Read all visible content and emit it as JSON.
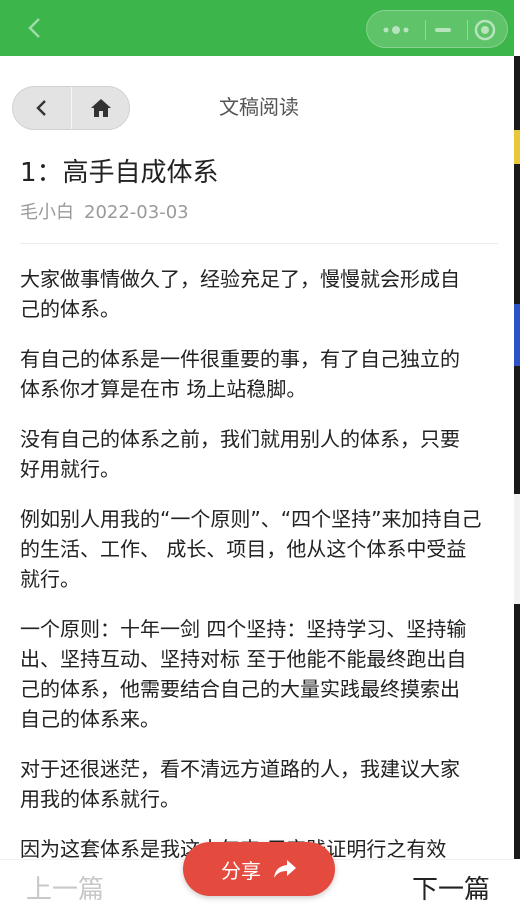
{
  "navbar": {
    "title": "文稿阅读"
  },
  "article": {
    "title": "1：高手自成体系",
    "author": "毛小白",
    "date": "2022-03-03",
    "paragraphs": [
      [
        "大家做事情做久了，经验充足了，慢慢就会形成自",
        "己的体系。"
      ],
      [
        "有自己的体系是一件很重要的事，有了自己独立的",
        "体系你才算是在市 场上站稳脚。"
      ],
      [
        "没有自己的体系之前，我们就用别人的体系，只要",
        "好用就行。"
      ],
      [
        "例如别人用我的“一个原则”、“四个坚持”来加持自己",
        "的生活、工作、 成长、项目，他从这个体系中受益",
        "就行。"
      ],
      [
        "一个原则：十年一剑 四个坚持：坚持学习、坚持输",
        "出、坚持互动、坚持对标 至于他能不能最终跑出自",
        "己的体系，他需要结合自己的大量实践最终摸索出",
        "自己的体系来。"
      ],
      [
        "对于还很迷茫，看不清远方道路的人，我建议大家",
        "用我的体系就行。"
      ],
      [
        "因为这套体系是我这十年来 用实践证明行之有效"
      ]
    ]
  },
  "bottom": {
    "prev_label": "上一篇",
    "next_label": "下一篇",
    "share_label": "分享"
  },
  "colors": {
    "topbar": "#3cb64a",
    "share": "#e54a3e"
  },
  "icons": [
    "back-arrow-icon",
    "more-dots-icon",
    "minimize-icon",
    "target-icon",
    "chevron-left-icon",
    "home-icon",
    "share-arrow-icon"
  ]
}
